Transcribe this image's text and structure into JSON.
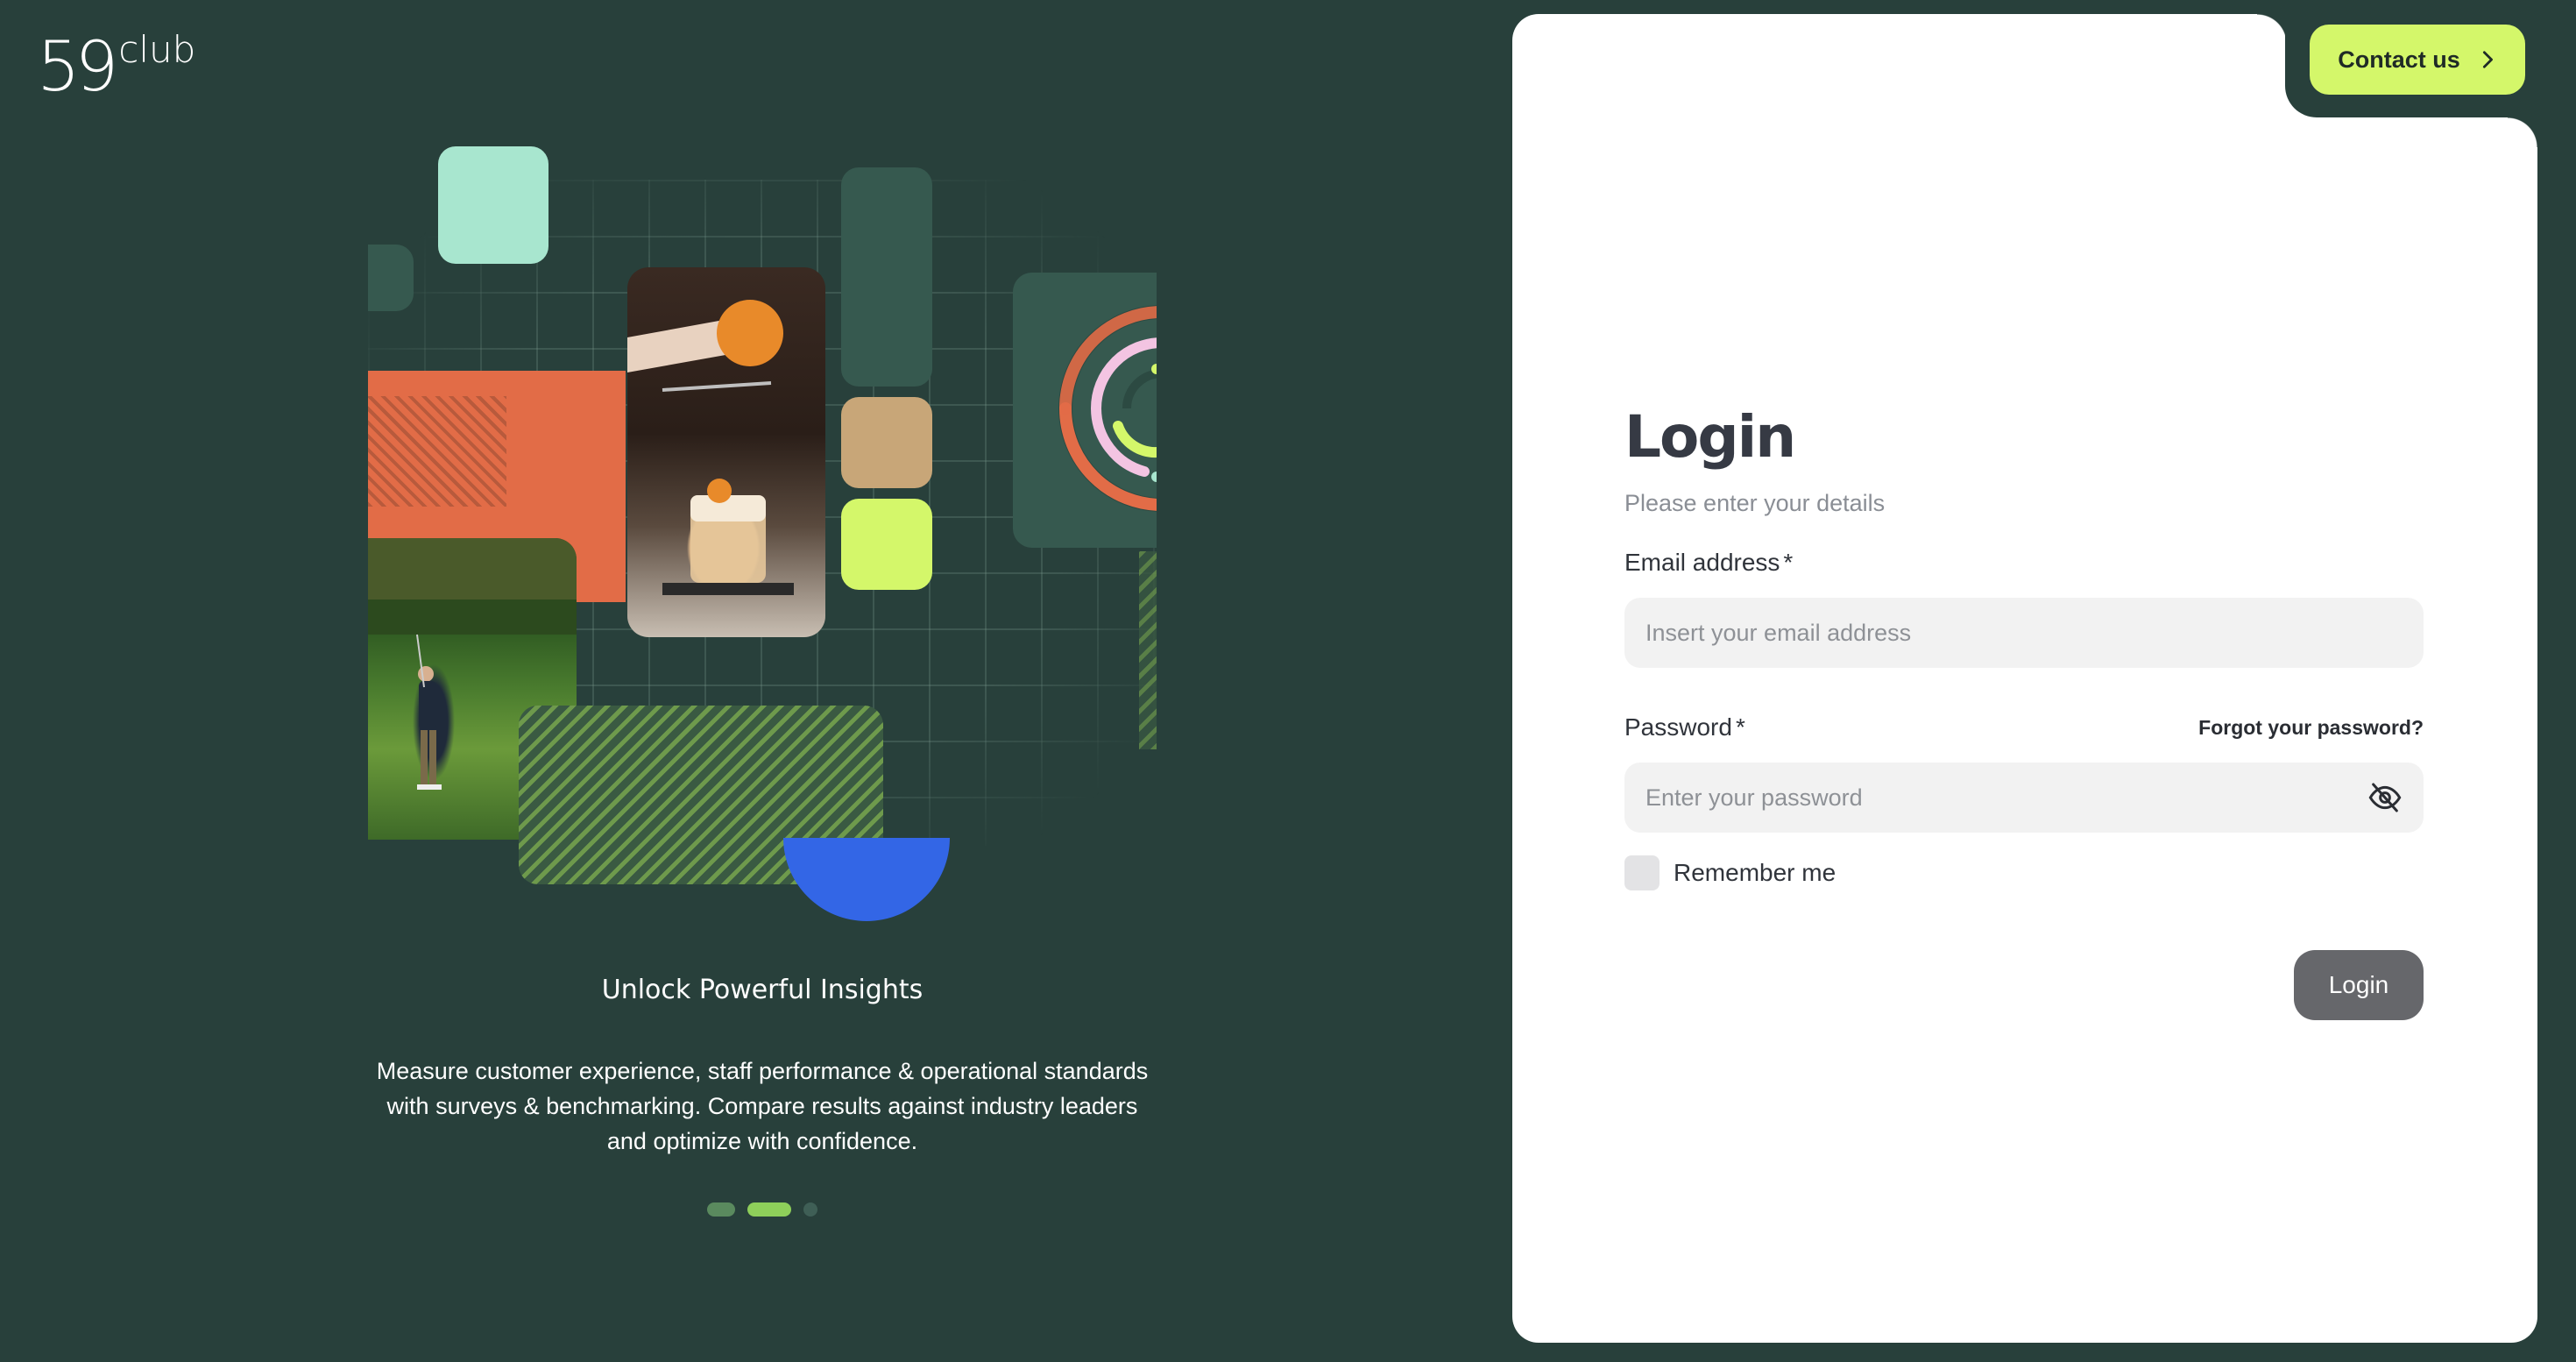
{
  "brand": {
    "logo_number": "59",
    "logo_word": "club"
  },
  "header": {
    "contact_label": "Contact us"
  },
  "carousel": {
    "title": "Unlock Powerful Insights",
    "description": "Measure customer experience, staff performance & operational standards with surveys & benchmarking. Compare results against industry leaders and optimize with confidence.",
    "active_index": 1,
    "count": 3
  },
  "login": {
    "title": "Login",
    "subtitle": "Please enter your details",
    "email_label": "Email address",
    "email_placeholder": "Insert your email address",
    "required_mark": "*",
    "password_label": "Password",
    "password_placeholder": "Enter your password",
    "forgot_label": "Forgot your password?",
    "remember_label": "Remember me",
    "remember_checked": false,
    "submit_label": "Login",
    "password_toggle_icon": "eye-off-icon"
  },
  "colors": {
    "background": "#28403b",
    "accent_lime": "#d4f76a",
    "accent_orange": "#e26c47",
    "accent_mint": "#a8e6cf",
    "accent_blue": "#3366e6",
    "accent_tan": "#c8a678",
    "button_disabled": "#66676b"
  }
}
